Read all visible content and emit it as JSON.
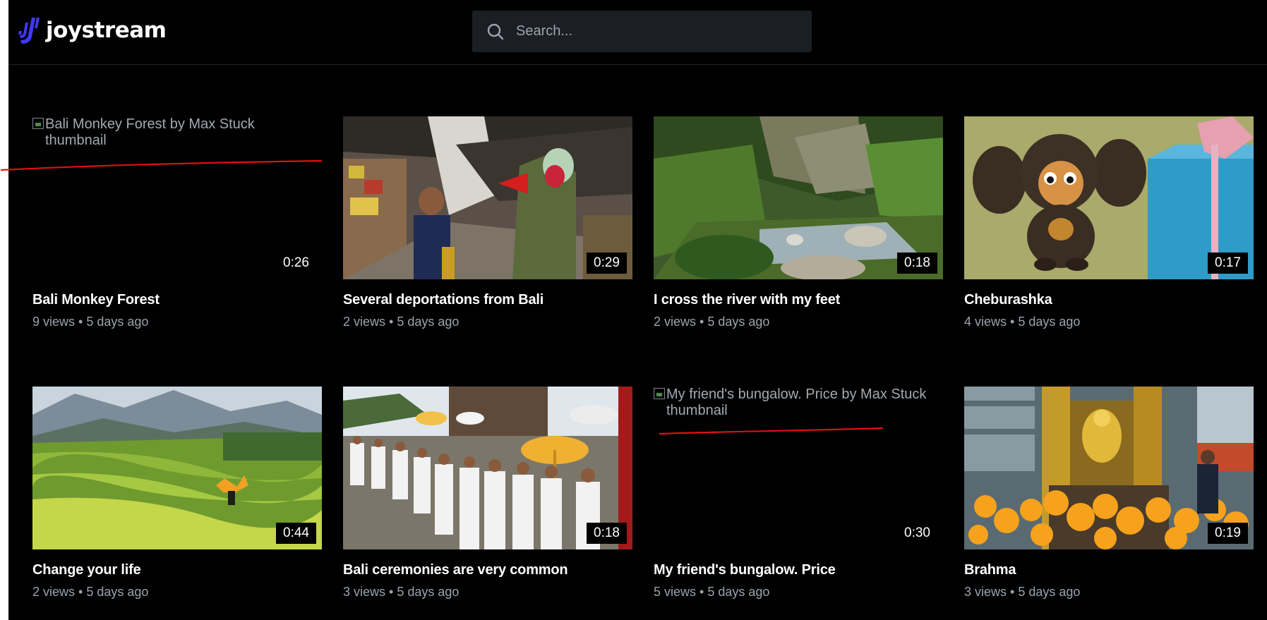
{
  "header": {
    "logo_text": "joystream",
    "search_placeholder": "Search..."
  },
  "colors": {
    "background": "#000000",
    "search_bg": "#1b1f24",
    "brand": "#4038ff",
    "meta_text": "#9aa3ad",
    "annotation": "#e01010"
  },
  "videos": [
    {
      "title": "Bali Monkey Forest",
      "stats": "9 views • 5 days ago",
      "duration": "0:26",
      "thumbnail_alt": "Bali Monkey Forest by Max Stuck thumbnail"
    },
    {
      "title": "Several deportations from Bali",
      "stats": "2 views • 5 days ago",
      "duration": "0:29"
    },
    {
      "title": "I cross the river with my feet",
      "stats": "2 views • 5 days ago",
      "duration": "0:18"
    },
    {
      "title": "Cheburashka",
      "stats": "4 views • 5 days ago",
      "duration": "0:17"
    },
    {
      "title": "Change your life",
      "stats": "2 views • 5 days ago",
      "duration": "0:44"
    },
    {
      "title": "Bali ceremonies are very common",
      "stats": "3 views • 5 days ago",
      "duration": "0:18"
    },
    {
      "title": "My friend's bungalow. Price",
      "stats": "5 views • 5 days ago",
      "duration": "0:30",
      "thumbnail_alt": "My friend's bungalow. Price by Max Stuck thumbnail"
    },
    {
      "title": "Brahma",
      "stats": "3 views • 5 days ago",
      "duration": "0:19"
    }
  ]
}
